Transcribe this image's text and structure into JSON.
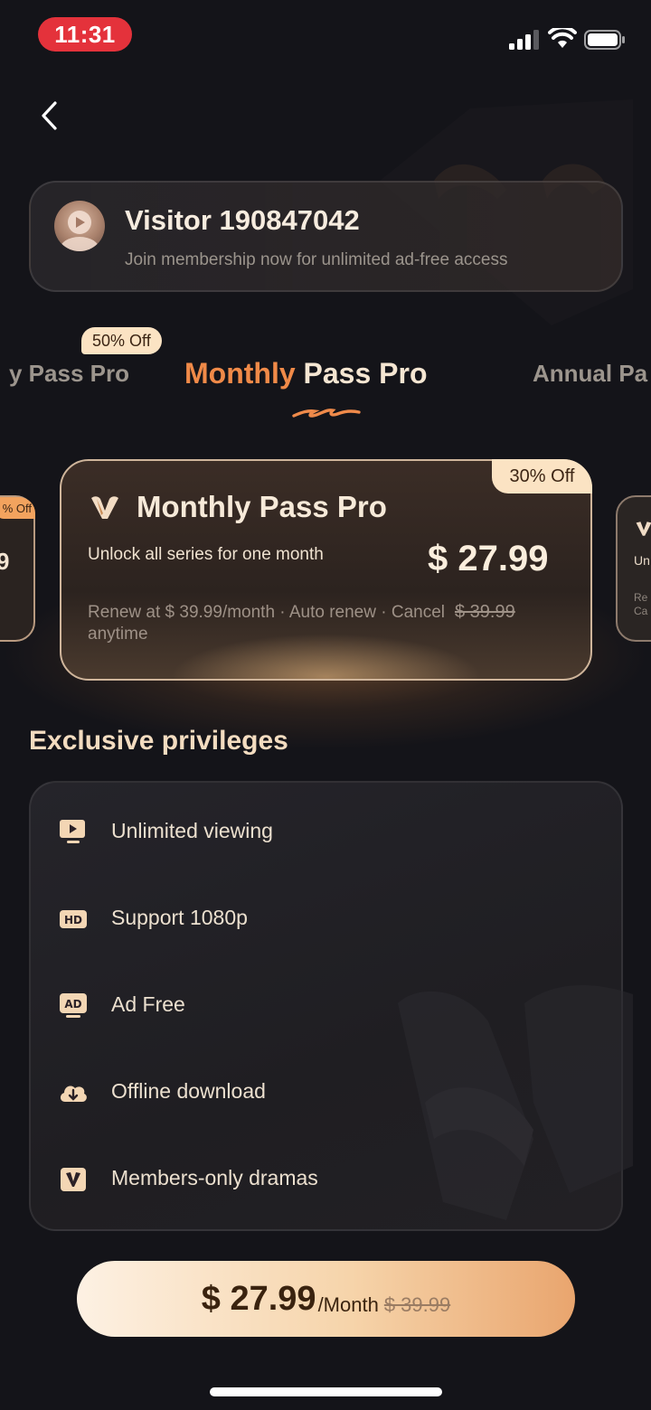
{
  "status_bar": {
    "time": "11:31",
    "icons": [
      "signal-icon",
      "wifi-icon",
      "battery-icon"
    ]
  },
  "nav": {
    "back_icon": "chevron-left-icon"
  },
  "profile": {
    "name": "Visitor 190847042",
    "subtitle": "Join membership now for unlimited ad-free access"
  },
  "plan_tabs": {
    "left": {
      "label": "y Pass Pro",
      "badge": "50% Off"
    },
    "active": {
      "label_part1": "Monthly",
      "label_part2": " Pass Pro"
    },
    "right": {
      "label": "Annual Pa"
    }
  },
  "side_cards": {
    "left": {
      "badge": "% Off",
      "price": "9"
    },
    "right": {
      "line1": "Un",
      "line2a": "Re",
      "line2b": "Ca"
    }
  },
  "plan_card": {
    "badge": "30% Off",
    "title": "Monthly Pass Pro",
    "description": "Unlock all series for one month",
    "price": "$ 27.99",
    "renew_text": "Renew at $ 39.99/month · Auto renew · Cancel anytime",
    "original_price": "$ 39.99"
  },
  "privileges": {
    "heading": "Exclusive privileges",
    "items": [
      {
        "label": "Unlimited viewing",
        "icon": "play-screen-icon"
      },
      {
        "label": "Support 1080p",
        "icon": "hd-icon"
      },
      {
        "label": "Ad Free",
        "icon": "ad-icon"
      },
      {
        "label": "Offline download",
        "icon": "cloud-download-icon"
      },
      {
        "label": "Members-only dramas",
        "icon": "vip-icon"
      }
    ]
  },
  "cta": {
    "price": "$ 27.99",
    "unit": "/Month",
    "original_price": "$ 39.99"
  },
  "colors": {
    "background": "#141419",
    "accent_orange": "#f08a48",
    "cream": "#fbe3c3",
    "status_red": "#e4323b"
  }
}
